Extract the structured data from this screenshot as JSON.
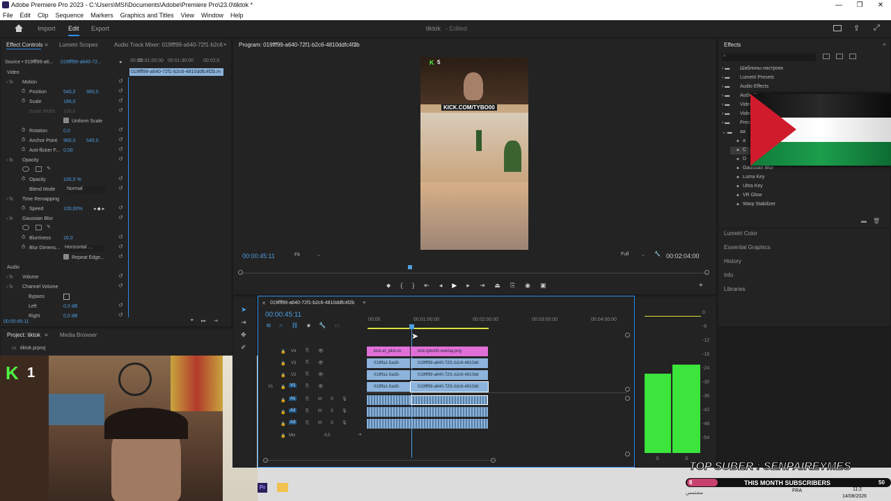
{
  "window": {
    "title": "Adobe Premiere Pro 2023 - C:\\Users\\MSI\\Documents\\Adobe\\Premiere Pro\\23.0\\tiktok *",
    "controls": [
      "—",
      "❐",
      "✕"
    ]
  },
  "menu": [
    "File",
    "Edit",
    "Clip",
    "Sequence",
    "Markers",
    "Graphics and Titles",
    "View",
    "Window",
    "Help"
  ],
  "header": {
    "tabs": [
      "Import",
      "Edit",
      "Export"
    ],
    "project_name": "tiktok",
    "status": "- Edited"
  },
  "effect_controls": {
    "tabs": [
      "Effect Controls",
      "Lumetri Scopes",
      "Audio Track Mixer: 019fff99-a640-72f1-b2c6"
    ],
    "source": "Source • 019fff99-a6...",
    "clip_select": "019fff99-a640-72...",
    "ruler": [
      "00:00",
      "00:01:00:00",
      "00:01:30:00",
      "00:02:0"
    ],
    "clip_name": "019fff99-a640-72f1-b2c6-4810ddfc4f2b.m",
    "sections": {
      "video": "Video",
      "motion": "Motion",
      "position": "Position",
      "position_x": "540,0",
      "position_y": "960,0",
      "scale": "Scale",
      "scale_v": "186,0",
      "scale_width": "Scale Width",
      "scale_width_v": "100,0",
      "uniform_scale": "Uniform Scale",
      "rotation": "Rotation",
      "rotation_v": "0,0",
      "anchor": "Anchor Point",
      "anchor_x": "960,0",
      "anchor_y": "540,0",
      "antiflicker": "Anti-flicker F...",
      "antiflicker_v": "0,00",
      "opacity_h": "Opacity",
      "opacity": "Opacity",
      "opacity_v": "100,0 %",
      "blend": "Blend Mode",
      "blend_v": "Normal",
      "time_remap": "Time Remapping",
      "speed": "Speed",
      "speed_v": "100,00%",
      "gaussian": "Gaussian Blur",
      "blurriness": "Blurriness",
      "blurriness_v": "16,0",
      "blur_dim": "Blur Dimens...",
      "blur_dim_v": "Horizontal ...",
      "repeat_edge": "Repeat Edge...",
      "audio": "Audio",
      "volume": "Volume",
      "channel_volume": "Channel Volume",
      "bypass": "Bypass",
      "left": "Left",
      "left_v": "0,0 dB",
      "right": "Right",
      "right_v": "0,0 dB"
    },
    "timecode": "00:00:45:11"
  },
  "program": {
    "title": "Program: 019fff99-a640-72f1-b2c6-4810ddfc4f2b",
    "timecode": "00:00:45:11",
    "fit": "Fit",
    "quality": "Full",
    "duration": "00:02:04:00",
    "overlay_k": "K",
    "overlay_k_num": "5",
    "overlay_url": "KICK.COM/TYBO00"
  },
  "effects": {
    "title": "Effects",
    "folders": [
      "Шаблоны настроек",
      "Lumetri Presets",
      "Audio Effects",
      "Audio Transitions",
      "Video Effects",
      "Video Transitions",
      "Presets",
      "aa"
    ],
    "items": [
      "a",
      "C",
      "D",
      "Gaussian Blur",
      "Luma Key",
      "Ultra Key",
      "VR Glow",
      "Warp Stabilizer"
    ],
    "panels": [
      "Lumetri Color",
      "Essential Graphics",
      "History",
      "Info",
      "Libraries"
    ]
  },
  "project": {
    "tabs": [
      "Project: tiktok",
      "Media Browser"
    ],
    "file": "tiktok.prproj",
    "cam_k": "K",
    "cam_num": "1"
  },
  "timeline": {
    "title": "019fff99-a640-72f1-b2c6-4810ddfc4f2b",
    "timecode": "00:00:45:11",
    "ruler": [
      "00:00",
      "00:01:00:00",
      "00:02:00:00",
      "00:03:00:00",
      "00:04:00:00"
    ],
    "video_tracks": [
      "V4",
      "V3",
      "V2",
      "V1"
    ],
    "v1_label": "V1",
    "audio_tracks": [
      "A1",
      "A2",
      "A3"
    ],
    "mix": "Mix",
    "mix_v": "0,0",
    "clips": {
      "v4_a": "kick-el_pilot-ov",
      "v4_b": "kick-tybo00-overlay.png",
      "v3_a": "019ffa1-5ad3-",
      "v3_b": "019fff99-a640-72f1-b2c6-4810dd",
      "v2_a": "019ffa1-5ad3-",
      "v2_b": "019fff99-a640-72f1-b2c6-4810dd",
      "v1_a": "019ffa1-5ad3-",
      "v1_b": "019fff99-a640-72f1-b2c6-4810dd"
    }
  },
  "meter": {
    "scale": [
      "0",
      "-6",
      "-12",
      "-18",
      "-24",
      "-30",
      "-36",
      "-42",
      "-48",
      "-54"
    ],
    "levels_db": [
      -27,
      -23
    ],
    "foot": [
      "S",
      "S"
    ]
  },
  "overlay": {
    "top_suber": "TOP SUBER : SENPAIREYMES",
    "subs": "THIS MONTH SUBSCRIBERS",
    "subs_count": "8",
    "subs_right": "50",
    "arabic": "مشتمس"
  },
  "taskbar": {
    "lang": "FRA",
    "time": "11:2",
    "date": "14/08/2026"
  },
  "colors": {
    "accent": "#2d8ceb",
    "clip_blue": "#8cb4dc",
    "clip_pink": "#e070d8",
    "meter_green": "#3be53b",
    "timecode_blue": "#4d9de0"
  }
}
